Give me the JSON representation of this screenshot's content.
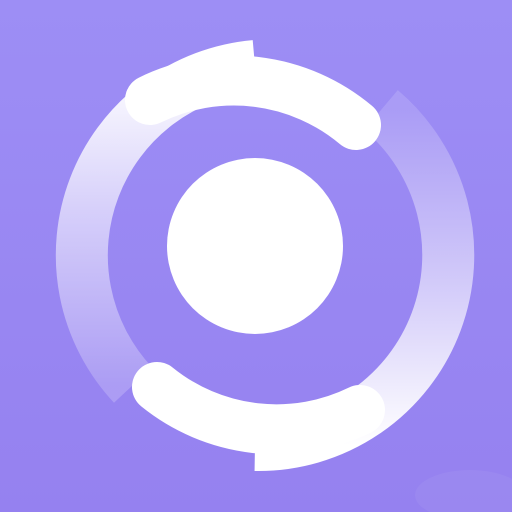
{
  "icon": {
    "name": "ring-with-center-dot-app-icon",
    "colors": {
      "background_top": "#9d8ef5",
      "background_bottom": "#9581f0",
      "ring": "#ffffff",
      "ring_faded": "#eae4ff",
      "center_dot": "#ffffff"
    }
  }
}
